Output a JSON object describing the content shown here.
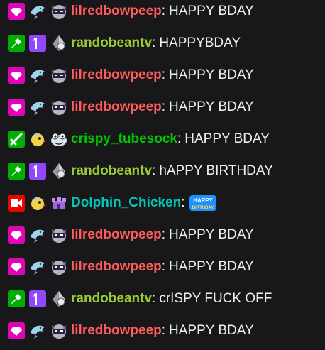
{
  "messages": [
    {
      "badges": [
        "prime-gaming-badge",
        "dolphin-sub-badge",
        "ninja-cat-badge"
      ],
      "username": "lilredbowpeep",
      "color": "#ff5b5b",
      "text": "HAPPY BDAY"
    },
    {
      "badges": [
        "moderator-badge",
        "first-badge",
        "gem-badge"
      ],
      "username": "randobeantv",
      "color": "#9acd32",
      "text": "HAPPYBDAY"
    },
    {
      "badges": [
        "prime-gaming-badge",
        "dolphin-sub-badge",
        "ninja-cat-badge"
      ],
      "username": "lilredbowpeep",
      "color": "#ff5b5b",
      "text": "HAPPY BDAY"
    },
    {
      "badges": [
        "prime-gaming-badge",
        "dolphin-sub-badge",
        "ninja-cat-badge"
      ],
      "username": "lilredbowpeep",
      "color": "#ff5b5b",
      "text": "HAPPY BDAY"
    },
    {
      "badges": [
        "sword-mod-badge",
        "bird-sub-badge",
        "frog-badge"
      ],
      "username": "crispy_tubesock",
      "color": "#00c800",
      "text": "HAPPY BDAY"
    },
    {
      "badges": [
        "moderator-badge",
        "first-badge",
        "gem-badge"
      ],
      "username": "randobeantv",
      "color": "#9acd32",
      "text": "hAPPY BIRTHDAY"
    },
    {
      "badges": [
        "broadcaster-badge",
        "bird-sub-badge",
        "castle-badge"
      ],
      "username": "Dolphin_Chicken",
      "color": "#00c8b4",
      "text": "",
      "emote": "happy-bday-emote",
      "emote_text": "HAPPY BIRTHDAY"
    },
    {
      "badges": [
        "prime-gaming-badge",
        "dolphin-sub-badge",
        "ninja-cat-badge"
      ],
      "username": "lilredbowpeep",
      "color": "#ff5b5b",
      "text": "HAPPY BDAY"
    },
    {
      "badges": [
        "prime-gaming-badge",
        "dolphin-sub-badge",
        "ninja-cat-badge"
      ],
      "username": "lilredbowpeep",
      "color": "#ff5b5b",
      "text": "HAPPY BDAY"
    },
    {
      "badges": [
        "moderator-badge",
        "first-badge",
        "gem-badge"
      ],
      "username": "randobeantv",
      "color": "#9acd32",
      "text": "crISPY FUCK OFF"
    },
    {
      "badges": [
        "prime-gaming-badge",
        "dolphin-sub-badge",
        "ninja-cat-badge"
      ],
      "username": "lilredbowpeep",
      "color": "#ff5b5b",
      "text": "HAPPY BDAY"
    }
  ]
}
